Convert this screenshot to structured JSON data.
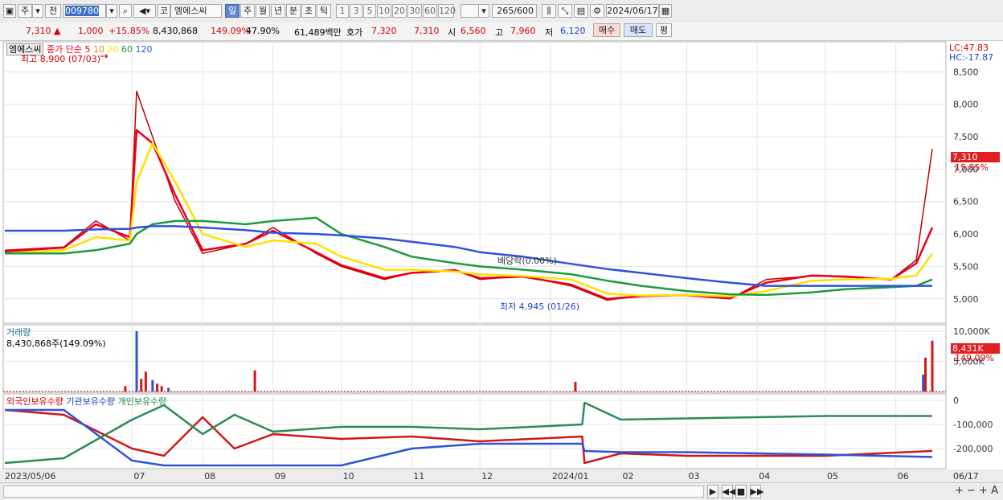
{
  "toolbar": {
    "mode": "주",
    "compare": "전",
    "code": "009780",
    "market": "코",
    "name": "엠에스씨",
    "periods": [
      "일",
      "주",
      "월",
      "년",
      "분",
      "초",
      "틱"
    ],
    "active_period": "일",
    "minutes": [
      "1",
      "3",
      "5",
      "10",
      "20",
      "30",
      "60",
      "120"
    ],
    "count": "265",
    "count_max": "/600",
    "date": "2024/06/17"
  },
  "quote": {
    "price": "7,310",
    "change": "1,000",
    "change_pct": "+15.85%",
    "volume": "8,430,868",
    "volume_ratio": "149.09%",
    "turnover": "47.90%",
    "amount": "61,489백만",
    "ask_label": "호가",
    "ask1": "7,320",
    "ask2": "7,310",
    "open_label": "시",
    "open": "6,560",
    "high_label": "고",
    "high": "7,960",
    "low_label": "저",
    "low": "6,120",
    "buy": "매수",
    "sell": "매도",
    "eval": "평"
  },
  "legend": {
    "name": "엠에스씨",
    "ma_label": "종가 단순",
    "ma": [
      "5",
      "10",
      "20",
      "60",
      "120"
    ],
    "ma_colors": [
      "#e8001c",
      "#f08a00",
      "#ffe000",
      "#1d9b3c",
      "#2f53d8"
    ],
    "high_note": "최고 8,900 (07/03)",
    "low_note": "최저 4,945 (01/26)",
    "dividend_note": "배당락(0.00%)",
    "lc": "LC:47.83",
    "hc": "HC:-17.87",
    "last_price": "7,310",
    "last_pct": "15.85%"
  },
  "volume_panel": {
    "title": "거래량",
    "info": "8,430,868주(149.09%)",
    "last": "8,431K",
    "last_pct": "149.09%",
    "axis": [
      "10,000K",
      "5,000K"
    ]
  },
  "holding_panel": {
    "series": [
      "외국인보유수량",
      "기관보유수량",
      "개인보유수량"
    ],
    "axis": [
      "0",
      "-100,000",
      "-200,000"
    ]
  },
  "xaxis": {
    "start": "2023/05/06",
    "labels": [
      "07",
      "08",
      "09",
      "10",
      "11",
      "12",
      "2024/01",
      "02",
      "03",
      "04",
      "05",
      "06",
      "06/17"
    ]
  },
  "chart_data": [
    {
      "type": "line",
      "title": "엠에스씨",
      "ylabel": "",
      "ylim": [
        4700,
        8900
      ],
      "yticks": [
        5000,
        5500,
        6000,
        6500,
        7000,
        7500,
        8000,
        8500
      ],
      "x": [
        "2023-05-06",
        "2023-06-01",
        "2023-06-15",
        "2023-06-30",
        "2023-07-03",
        "2023-07-10",
        "2023-07-20",
        "2023-08-01",
        "2023-08-20",
        "2023-09-01",
        "2023-09-20",
        "2023-10-01",
        "2023-10-20",
        "2023-11-01",
        "2023-11-20",
        "2023-12-01",
        "2023-12-20",
        "2024-01-10",
        "2024-01-26",
        "2024-02-10",
        "2024-03-01",
        "2024-03-20",
        "2024-04-05",
        "2024-04-25",
        "2024-05-10",
        "2024-05-30",
        "2024-06-10",
        "2024-06-17"
      ],
      "series": [
        {
          "name": "종가",
          "values": [
            5750,
            5800,
            6200,
            5900,
            8200,
            7500,
            6500,
            5700,
            5850,
            6100,
            5700,
            5500,
            5300,
            5400,
            5450,
            5300,
            5350,
            5200,
            4980,
            5050,
            5050,
            5000,
            5300,
            5350,
            5350,
            5300,
            5600,
            7310
          ]
        },
        {
          "name": "5",
          "values": [
            5730,
            5790,
            6150,
            5950,
            7600,
            7400,
            6600,
            5750,
            5850,
            6050,
            5720,
            5520,
            5320,
            5400,
            5440,
            5320,
            5340,
            5220,
            5000,
            5040,
            5060,
            5010,
            5250,
            5360,
            5340,
            5300,
            5550,
            6100
          ]
        },
        {
          "name": "20",
          "values": [
            5700,
            5750,
            5950,
            5900,
            6800,
            7400,
            6800,
            6000,
            5800,
            5900,
            5850,
            5650,
            5450,
            5450,
            5420,
            5380,
            5350,
            5300,
            5080,
            5050,
            5060,
            5040,
            5120,
            5280,
            5300,
            5310,
            5360,
            5700
          ]
        },
        {
          "name": "60",
          "values": [
            5700,
            5700,
            5750,
            5850,
            6000,
            6150,
            6200,
            6200,
            6150,
            6200,
            6250,
            6000,
            5800,
            5650,
            5550,
            5500,
            5450,
            5380,
            5280,
            5200,
            5120,
            5070,
            5060,
            5100,
            5150,
            5180,
            5200,
            5300
          ]
        },
        {
          "name": "120",
          "values": [
            6050,
            6050,
            6070,
            6080,
            6100,
            6120,
            6120,
            6100,
            6060,
            6020,
            6000,
            5980,
            5930,
            5880,
            5800,
            5720,
            5650,
            5540,
            5460,
            5400,
            5320,
            5250,
            5200,
            5200,
            5200,
            5200,
            5200,
            5200
          ]
        }
      ],
      "annotations": [
        "최고 8,900 (07/03)",
        "최저 4,945 (01/26)",
        "배당락(0.00%)"
      ]
    },
    {
      "type": "bar",
      "title": "거래량",
      "ylim": [
        0,
        10000
      ],
      "ylabel": "",
      "x": [
        "2023-06-28",
        "2023-07-03",
        "2023-07-05",
        "2023-07-07",
        "2023-07-10",
        "2023-07-12",
        "2023-07-14",
        "2023-07-17",
        "2023-08-24",
        "2024-01-12",
        "2024-06-13",
        "2024-06-14",
        "2024-06-17"
      ],
      "values": [
        900,
        10000,
        2100,
        3300,
        1900,
        1300,
        900,
        600,
        3500,
        1600,
        2800,
        5600,
        8431
      ]
    },
    {
      "type": "line",
      "title": "",
      "ylim": [
        -280000,
        20000
      ],
      "x": [
        "2023-05-06",
        "2023-06-01",
        "2023-07-01",
        "2023-07-15",
        "2023-08-01",
        "2023-08-15",
        "2023-09-01",
        "2023-10-01",
        "2023-11-01",
        "2023-12-01",
        "2024-01-15",
        "2024-01-16",
        "2024-02-01",
        "2024-03-01",
        "2024-04-01",
        "2024-05-01",
        "2024-06-17"
      ],
      "series": [
        {
          "name": "외국인보유수량",
          "values": [
            -40000,
            -60000,
            -200000,
            -230000,
            -70000,
            -200000,
            -140000,
            -160000,
            -150000,
            -170000,
            -150000,
            -260000,
            -220000,
            -230000,
            -230000,
            -230000,
            -210000
          ]
        },
        {
          "name": "기관보유수량",
          "values": [
            -40000,
            -40000,
            -250000,
            -270000,
            -270000,
            -270000,
            -270000,
            -270000,
            -200000,
            -180000,
            -180000,
            -210000,
            -215000,
            -215000,
            -220000,
            -225000,
            -235000
          ]
        },
        {
          "name": "개인보유수량",
          "values": [
            -260000,
            -240000,
            -80000,
            -20000,
            -140000,
            -60000,
            -130000,
            -110000,
            -110000,
            -120000,
            -100000,
            -10000,
            -80000,
            -75000,
            -70000,
            -65000,
            -65000
          ]
        }
      ]
    }
  ]
}
